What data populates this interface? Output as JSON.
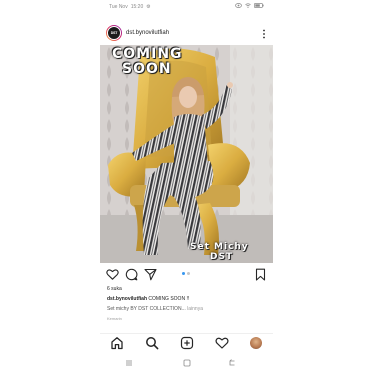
{
  "status_bar": {
    "left_text": "Tue Nov",
    "time": "15:20",
    "battery": "▭"
  },
  "post": {
    "username": "dst.bynovilutfiah",
    "avatar_text": "DST",
    "overlay_title_line1": "COMING",
    "overlay_title_line2": "SOON",
    "overlay_caption_line1": "Set Michy",
    "overlay_caption_line2": "DST",
    "likes": "6 suka",
    "caption_username": "dst.bynovilutfiah",
    "caption_text": "COMING SOON !!",
    "caption_line2": "Set michy BY DST COLLECTION...",
    "more_label": "lainnya",
    "timestamp": "Kemarin",
    "carousel": {
      "count": 2,
      "active": 1
    }
  },
  "icons": {
    "like": "heart-icon",
    "comment": "comment-icon",
    "share": "send-icon",
    "save": "bookmark-icon",
    "more": "more-vertical-icon",
    "home": "home-icon",
    "search": "search-icon",
    "new_post": "add-post-icon",
    "activity": "heart-icon",
    "profile": "profile-avatar"
  },
  "colors": {
    "accent": "#3897f0",
    "text": "#262626",
    "muted": "#9a9a9a"
  }
}
